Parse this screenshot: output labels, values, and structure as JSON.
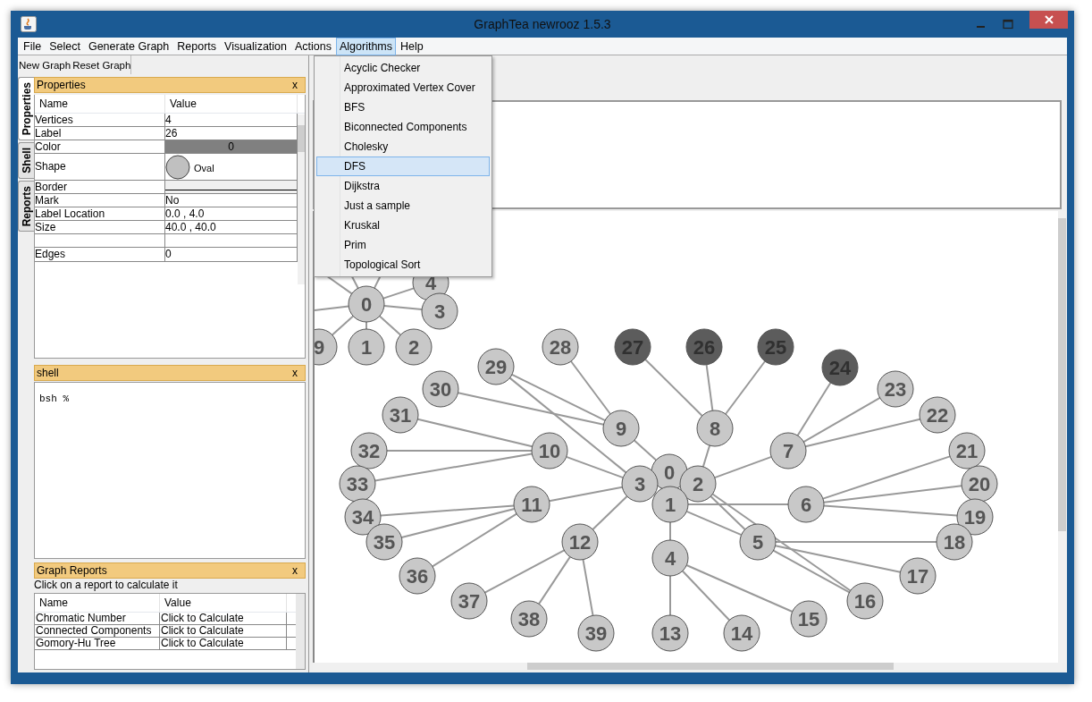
{
  "window": {
    "title": "GraphTea newrooz 1.5.3"
  },
  "menu": [
    {
      "label": "File",
      "selected": false
    },
    {
      "label": "Select",
      "selected": false
    },
    {
      "label": "Generate Graph",
      "selected": false
    },
    {
      "label": "Reports",
      "selected": false
    },
    {
      "label": "Visualization",
      "selected": false
    },
    {
      "label": "Actions",
      "selected": false
    },
    {
      "label": "Algorithms",
      "selected": true
    },
    {
      "label": "Help",
      "selected": false
    }
  ],
  "algorithms_menu": [
    {
      "label": "Acyclic Checker",
      "selected": false
    },
    {
      "label": "Approximated Vertex Cover",
      "selected": false
    },
    {
      "label": "BFS",
      "selected": false
    },
    {
      "label": "Biconnected Components",
      "selected": false
    },
    {
      "label": "Cholesky",
      "selected": false
    },
    {
      "label": "DFS",
      "selected": true
    },
    {
      "label": "Dijkstra",
      "selected": false
    },
    {
      "label": "Just a sample",
      "selected": false
    },
    {
      "label": "Kruskal",
      "selected": false
    },
    {
      "label": "Prim",
      "selected": false
    },
    {
      "label": "Topological Sort",
      "selected": false
    }
  ],
  "toolbar": [
    "New Graph",
    "Reset Graph"
  ],
  "side_tabs": [
    {
      "label": "Properties",
      "selected": true
    },
    {
      "label": "Shell",
      "selected": false
    },
    {
      "label": "Reports",
      "selected": false
    }
  ],
  "properties": {
    "title": "Properties",
    "close": "x",
    "columns": [
      "Name",
      "Value"
    ],
    "rows": [
      {
        "kind": "text",
        "name": "Vertices",
        "value": "4"
      },
      {
        "kind": "text",
        "name": "Label",
        "value": "26"
      },
      {
        "kind": "color",
        "name": "Color",
        "value": "0"
      },
      {
        "kind": "shape",
        "name": "Shape",
        "value": "Oval"
      },
      {
        "kind": "border",
        "name": "Border"
      },
      {
        "kind": "text",
        "name": "Mark",
        "value": "No"
      },
      {
        "kind": "text",
        "name": "Label Location",
        "value": "0.0 , 4.0"
      },
      {
        "kind": "text",
        "name": "Size",
        "value": "40.0 , 40.0"
      },
      {
        "kind": "blank"
      },
      {
        "kind": "text",
        "name": "Edges",
        "value": "0"
      }
    ]
  },
  "shell": {
    "title": "shell",
    "close": "x",
    "prompt": "bsh %"
  },
  "reports": {
    "title": "Graph Reports",
    "close": "x",
    "hint": "Click on a report to calculate it",
    "columns": [
      "Name",
      "Value"
    ],
    "rows": [
      {
        "name": "Chromatic Number",
        "value": "Click to Calculate"
      },
      {
        "name": "Connected Components",
        "value": "Click to Calculate"
      },
      {
        "name": "Gomory-Hu Tree",
        "value": "Click to Calculate"
      }
    ]
  },
  "graph": {
    "nodes": [
      {
        "label": "4",
        "selected": false
      },
      {
        "label": "0",
        "selected": false
      },
      {
        "label": "3",
        "selected": false
      },
      {
        "label": "9",
        "selected": false
      },
      {
        "label": "1",
        "selected": false
      },
      {
        "label": "2",
        "selected": false
      },
      {
        "label": "28",
        "selected": false
      },
      {
        "label": "27",
        "selected": true
      },
      {
        "label": "26",
        "selected": true
      },
      {
        "label": "25",
        "selected": true
      },
      {
        "label": "29",
        "selected": false
      },
      {
        "label": "24",
        "selected": true
      },
      {
        "label": "30",
        "selected": false
      },
      {
        "label": "23",
        "selected": false
      },
      {
        "label": "31",
        "selected": false
      },
      {
        "label": "22",
        "selected": false
      },
      {
        "label": "9",
        "selected": false
      },
      {
        "label": "8",
        "selected": false
      },
      {
        "label": "32",
        "selected": false
      },
      {
        "label": "10",
        "selected": false
      },
      {
        "label": "7",
        "selected": false
      },
      {
        "label": "21",
        "selected": false
      },
      {
        "label": "0",
        "selected": false
      },
      {
        "label": "33",
        "selected": false
      },
      {
        "label": "3",
        "selected": false
      },
      {
        "label": "2",
        "selected": false
      },
      {
        "label": "20",
        "selected": false
      },
      {
        "label": "11",
        "selected": false
      },
      {
        "label": "1",
        "selected": false
      },
      {
        "label": "6",
        "selected": false
      },
      {
        "label": "34",
        "selected": false
      },
      {
        "label": "19",
        "selected": false
      },
      {
        "label": "35",
        "selected": false
      },
      {
        "label": "12",
        "selected": false
      },
      {
        "label": "5",
        "selected": false
      },
      {
        "label": "18",
        "selected": false
      },
      {
        "label": "4",
        "selected": false
      },
      {
        "label": "36",
        "selected": false
      },
      {
        "label": "17",
        "selected": false
      },
      {
        "label": "37",
        "selected": false
      },
      {
        "label": "16",
        "selected": false
      },
      {
        "label": "38",
        "selected": false
      },
      {
        "label": "15",
        "selected": false
      },
      {
        "label": "39",
        "selected": false
      },
      {
        "label": "13",
        "selected": false
      },
      {
        "label": "14",
        "selected": false
      }
    ]
  }
}
